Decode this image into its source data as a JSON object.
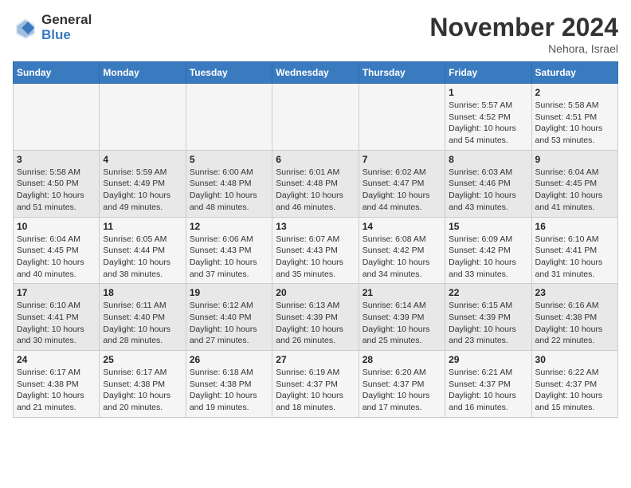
{
  "logo": {
    "line1": "General",
    "line2": "Blue"
  },
  "title": "November 2024",
  "subtitle": "Nehora, Israel",
  "days_header": [
    "Sunday",
    "Monday",
    "Tuesday",
    "Wednesday",
    "Thursday",
    "Friday",
    "Saturday"
  ],
  "weeks": [
    [
      {
        "num": "",
        "sunrise": "",
        "sunset": "",
        "daylight": ""
      },
      {
        "num": "",
        "sunrise": "",
        "sunset": "",
        "daylight": ""
      },
      {
        "num": "",
        "sunrise": "",
        "sunset": "",
        "daylight": ""
      },
      {
        "num": "",
        "sunrise": "",
        "sunset": "",
        "daylight": ""
      },
      {
        "num": "",
        "sunrise": "",
        "sunset": "",
        "daylight": ""
      },
      {
        "num": "1",
        "sunrise": "Sunrise: 5:57 AM",
        "sunset": "Sunset: 4:52 PM",
        "daylight": "Daylight: 10 hours and 54 minutes."
      },
      {
        "num": "2",
        "sunrise": "Sunrise: 5:58 AM",
        "sunset": "Sunset: 4:51 PM",
        "daylight": "Daylight: 10 hours and 53 minutes."
      }
    ],
    [
      {
        "num": "3",
        "sunrise": "Sunrise: 5:58 AM",
        "sunset": "Sunset: 4:50 PM",
        "daylight": "Daylight: 10 hours and 51 minutes."
      },
      {
        "num": "4",
        "sunrise": "Sunrise: 5:59 AM",
        "sunset": "Sunset: 4:49 PM",
        "daylight": "Daylight: 10 hours and 49 minutes."
      },
      {
        "num": "5",
        "sunrise": "Sunrise: 6:00 AM",
        "sunset": "Sunset: 4:48 PM",
        "daylight": "Daylight: 10 hours and 48 minutes."
      },
      {
        "num": "6",
        "sunrise": "Sunrise: 6:01 AM",
        "sunset": "Sunset: 4:48 PM",
        "daylight": "Daylight: 10 hours and 46 minutes."
      },
      {
        "num": "7",
        "sunrise": "Sunrise: 6:02 AM",
        "sunset": "Sunset: 4:47 PM",
        "daylight": "Daylight: 10 hours and 44 minutes."
      },
      {
        "num": "8",
        "sunrise": "Sunrise: 6:03 AM",
        "sunset": "Sunset: 4:46 PM",
        "daylight": "Daylight: 10 hours and 43 minutes."
      },
      {
        "num": "9",
        "sunrise": "Sunrise: 6:04 AM",
        "sunset": "Sunset: 4:45 PM",
        "daylight": "Daylight: 10 hours and 41 minutes."
      }
    ],
    [
      {
        "num": "10",
        "sunrise": "Sunrise: 6:04 AM",
        "sunset": "Sunset: 4:45 PM",
        "daylight": "Daylight: 10 hours and 40 minutes."
      },
      {
        "num": "11",
        "sunrise": "Sunrise: 6:05 AM",
        "sunset": "Sunset: 4:44 PM",
        "daylight": "Daylight: 10 hours and 38 minutes."
      },
      {
        "num": "12",
        "sunrise": "Sunrise: 6:06 AM",
        "sunset": "Sunset: 4:43 PM",
        "daylight": "Daylight: 10 hours and 37 minutes."
      },
      {
        "num": "13",
        "sunrise": "Sunrise: 6:07 AM",
        "sunset": "Sunset: 4:43 PM",
        "daylight": "Daylight: 10 hours and 35 minutes."
      },
      {
        "num": "14",
        "sunrise": "Sunrise: 6:08 AM",
        "sunset": "Sunset: 4:42 PM",
        "daylight": "Daylight: 10 hours and 34 minutes."
      },
      {
        "num": "15",
        "sunrise": "Sunrise: 6:09 AM",
        "sunset": "Sunset: 4:42 PM",
        "daylight": "Daylight: 10 hours and 33 minutes."
      },
      {
        "num": "16",
        "sunrise": "Sunrise: 6:10 AM",
        "sunset": "Sunset: 4:41 PM",
        "daylight": "Daylight: 10 hours and 31 minutes."
      }
    ],
    [
      {
        "num": "17",
        "sunrise": "Sunrise: 6:10 AM",
        "sunset": "Sunset: 4:41 PM",
        "daylight": "Daylight: 10 hours and 30 minutes."
      },
      {
        "num": "18",
        "sunrise": "Sunrise: 6:11 AM",
        "sunset": "Sunset: 4:40 PM",
        "daylight": "Daylight: 10 hours and 28 minutes."
      },
      {
        "num": "19",
        "sunrise": "Sunrise: 6:12 AM",
        "sunset": "Sunset: 4:40 PM",
        "daylight": "Daylight: 10 hours and 27 minutes."
      },
      {
        "num": "20",
        "sunrise": "Sunrise: 6:13 AM",
        "sunset": "Sunset: 4:39 PM",
        "daylight": "Daylight: 10 hours and 26 minutes."
      },
      {
        "num": "21",
        "sunrise": "Sunrise: 6:14 AM",
        "sunset": "Sunset: 4:39 PM",
        "daylight": "Daylight: 10 hours and 25 minutes."
      },
      {
        "num": "22",
        "sunrise": "Sunrise: 6:15 AM",
        "sunset": "Sunset: 4:39 PM",
        "daylight": "Daylight: 10 hours and 23 minutes."
      },
      {
        "num": "23",
        "sunrise": "Sunrise: 6:16 AM",
        "sunset": "Sunset: 4:38 PM",
        "daylight": "Daylight: 10 hours and 22 minutes."
      }
    ],
    [
      {
        "num": "24",
        "sunrise": "Sunrise: 6:17 AM",
        "sunset": "Sunset: 4:38 PM",
        "daylight": "Daylight: 10 hours and 21 minutes."
      },
      {
        "num": "25",
        "sunrise": "Sunrise: 6:17 AM",
        "sunset": "Sunset: 4:38 PM",
        "daylight": "Daylight: 10 hours and 20 minutes."
      },
      {
        "num": "26",
        "sunrise": "Sunrise: 6:18 AM",
        "sunset": "Sunset: 4:38 PM",
        "daylight": "Daylight: 10 hours and 19 minutes."
      },
      {
        "num": "27",
        "sunrise": "Sunrise: 6:19 AM",
        "sunset": "Sunset: 4:37 PM",
        "daylight": "Daylight: 10 hours and 18 minutes."
      },
      {
        "num": "28",
        "sunrise": "Sunrise: 6:20 AM",
        "sunset": "Sunset: 4:37 PM",
        "daylight": "Daylight: 10 hours and 17 minutes."
      },
      {
        "num": "29",
        "sunrise": "Sunrise: 6:21 AM",
        "sunset": "Sunset: 4:37 PM",
        "daylight": "Daylight: 10 hours and 16 minutes."
      },
      {
        "num": "30",
        "sunrise": "Sunrise: 6:22 AM",
        "sunset": "Sunset: 4:37 PM",
        "daylight": "Daylight: 10 hours and 15 minutes."
      }
    ]
  ]
}
